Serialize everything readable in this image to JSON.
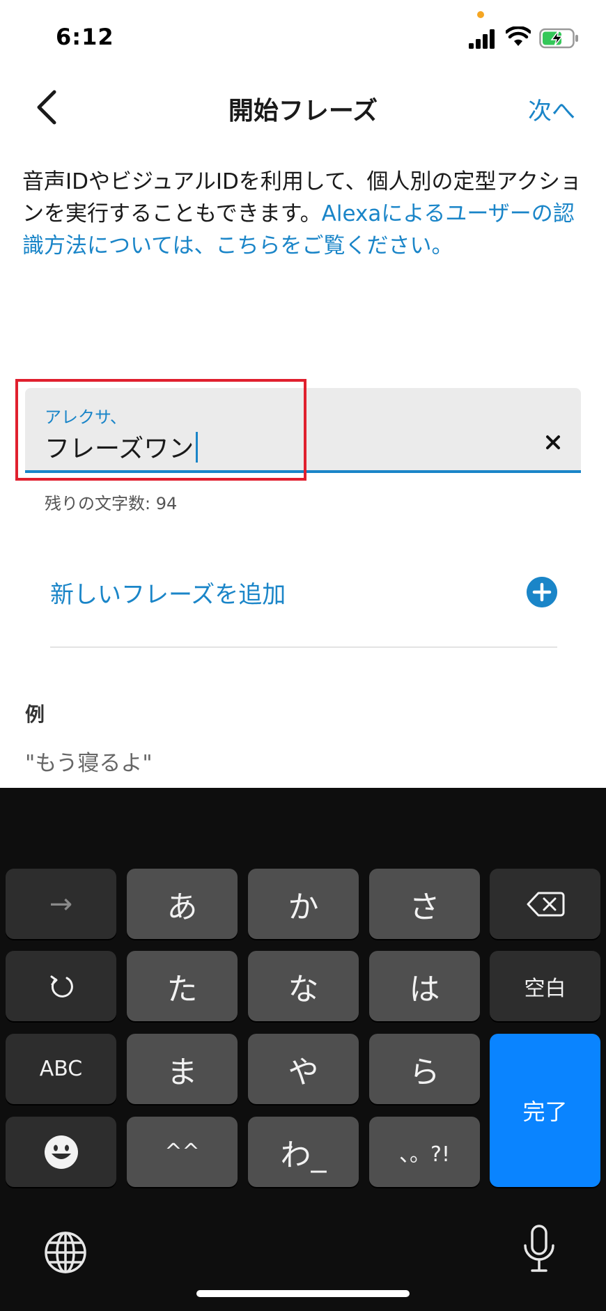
{
  "status_bar": {
    "time": "6:12"
  },
  "nav": {
    "title": "開始フレーズ",
    "next_label": "次へ"
  },
  "description": {
    "text": "音声IDやビジュアルIDを利用して、個人別の定型アクションを実行することもできます。",
    "link": "Alexaによるユーザーの認識方法については、こちらをご覧ください。"
  },
  "phrase_input": {
    "label": "アレクサ、",
    "value": "フレーズワン",
    "char_count": "残りの文字数: 94"
  },
  "add_phrase": {
    "label": "新しいフレーズを追加"
  },
  "example": {
    "heading": "例",
    "text": "\"もう寝るよ\""
  },
  "keyboard": {
    "rows": [
      [
        "→",
        "あ",
        "か",
        "さ",
        "delete"
      ],
      [
        "undo",
        "た",
        "な",
        "は",
        "空白"
      ],
      [
        "ABC",
        "ま",
        "や",
        "ら",
        "完了"
      ],
      [
        "emoji",
        "^^",
        "わ_",
        "、。?!"
      ]
    ],
    "accent_color": "#0a84ff"
  },
  "colors": {
    "link": "#1a85c8",
    "highlight": "#e0202e"
  }
}
